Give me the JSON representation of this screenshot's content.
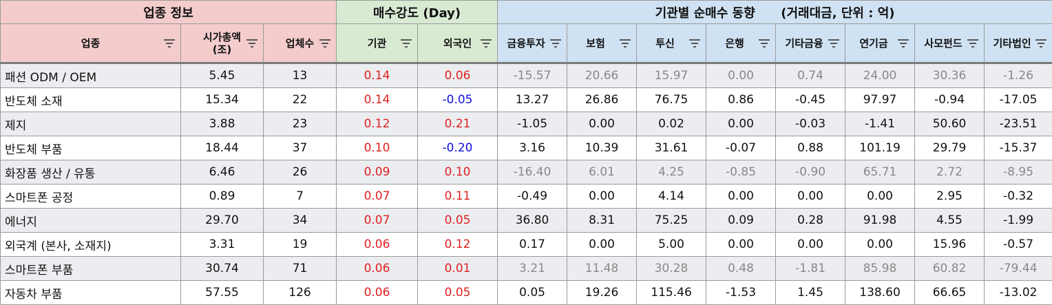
{
  "header": {
    "group1": "업종 정보",
    "group2": "매수강도 (Day)",
    "group3": "기관별 순매수 동향      (거래대금, 단위 : 억)",
    "columns": [
      "업종",
      "시가총액\n(조)",
      "업체수",
      "기관",
      "외국인",
      "금융투자",
      "보험",
      "투신",
      "은행",
      "기타금융",
      "연기금",
      "사모펀드",
      "기타법인"
    ]
  },
  "colors": {
    "positive": "#e02020",
    "negative": "#1010e0",
    "header_pink": "#f4cccc",
    "header_green": "#d9ead3",
    "header_blue": "#cfe2f3"
  },
  "rows": [
    [
      "패션 ODM / OEM",
      "5.45",
      "13",
      "0.14",
      "0.06",
      "-15.57",
      "20.66",
      "15.97",
      "0.00",
      "0.74",
      "24.00",
      "30.36",
      "-1.26"
    ],
    [
      "반도체 소재",
      "15.34",
      "22",
      "0.14",
      "-0.05",
      "13.27",
      "26.86",
      "76.75",
      "0.86",
      "-0.45",
      "97.97",
      "-0.94",
      "-17.05"
    ],
    [
      "제지",
      "3.88",
      "23",
      "0.12",
      "0.21",
      "-1.05",
      "0.00",
      "0.02",
      "0.00",
      "-0.03",
      "-1.41",
      "50.60",
      "-23.51"
    ],
    [
      "반도체 부품",
      "18.44",
      "37",
      "0.10",
      "-0.20",
      "3.16",
      "10.39",
      "31.61",
      "-0.07",
      "0.88",
      "101.19",
      "29.79",
      "-15.37"
    ],
    [
      "화장품 생산 / 유통",
      "6.46",
      "26",
      "0.09",
      "0.10",
      "-16.40",
      "6.01",
      "4.25",
      "-0.85",
      "-0.90",
      "65.71",
      "2.72",
      "-8.95"
    ],
    [
      "스마트폰 공정",
      "0.89",
      "7",
      "0.07",
      "0.11",
      "-0.49",
      "0.00",
      "4.14",
      "0.00",
      "0.00",
      "0.00",
      "2.95",
      "-0.32"
    ],
    [
      "에너지",
      "29.70",
      "34",
      "0.07",
      "0.05",
      "36.80",
      "8.31",
      "75.25",
      "0.09",
      "0.28",
      "91.98",
      "4.55",
      "-1.99"
    ],
    [
      "외국계 (본사, 소재지)",
      "3.31",
      "19",
      "0.06",
      "0.12",
      "0.17",
      "0.00",
      "5.00",
      "0.00",
      "0.00",
      "0.00",
      "15.96",
      "-0.57"
    ],
    [
      "스마트폰 부품",
      "30.74",
      "71",
      "0.06",
      "0.01",
      "3.21",
      "11.48",
      "30.28",
      "0.48",
      "-1.81",
      "85.98",
      "60.82",
      "-79.44"
    ],
    [
      "자동차 부품",
      "57.55",
      "126",
      "0.06",
      "0.05",
      "0.05",
      "19.26",
      "115.46",
      "-1.53",
      "1.45",
      "138.60",
      "66.65",
      "-13.02"
    ]
  ]
}
